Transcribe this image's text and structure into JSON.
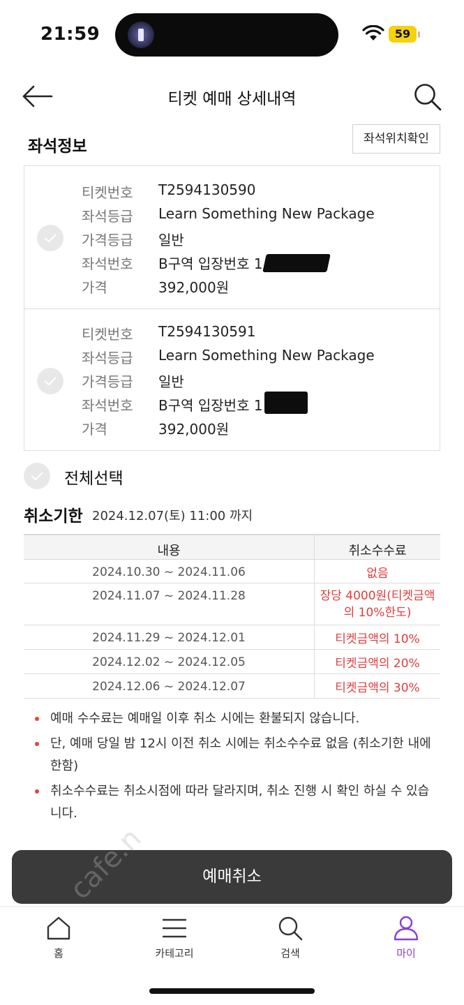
{
  "status_bar": {
    "time": "21:59",
    "battery": "59"
  },
  "header": {
    "title": "티켓 예매 상세내역"
  },
  "seat_info": {
    "section_title": "좌석정보",
    "locate_button": "좌석위치확인",
    "labels": {
      "ticket_no": "티켓번호",
      "seat_grade": "좌석등급",
      "price_grade": "가격등급",
      "seat_no": "좌석번호",
      "price": "가격"
    },
    "tickets": [
      {
        "ticket_no": "T2594130590",
        "seat_grade": "Learn Something New Package",
        "price_grade": "일반",
        "seat_no": "B구역 입장번호 1",
        "price": "392,000원"
      },
      {
        "ticket_no": "T2594130591",
        "seat_grade": "Learn Something New Package",
        "price_grade": "일반",
        "seat_no": "B구역 입장번호 1",
        "price": "392,000원"
      }
    ],
    "select_all": "전체선택"
  },
  "deadline": {
    "title": "취소기한",
    "value": "2024.12.07(토) 11:00 까지"
  },
  "fee_table": {
    "headers": {
      "period": "내용",
      "fee": "취소수수료"
    },
    "rows": [
      {
        "period": "2024.10.30 ~ 2024.11.06",
        "fee": "없음"
      },
      {
        "period": "2024.11.07 ~ 2024.11.28",
        "fee": "장당 4000원(티켓금액의 10%한도)"
      },
      {
        "period": "2024.11.29 ~ 2024.12.01",
        "fee": "티켓금액의 10%"
      },
      {
        "period": "2024.12.02 ~ 2024.12.05",
        "fee": "티켓금액의 20%"
      },
      {
        "period": "2024.12.06 ~ 2024.12.07",
        "fee": "티켓금액의 30%"
      }
    ]
  },
  "notes": [
    "예매 수수료는 예매일 이후 취소 시에는 환불되지 않습니다.",
    "단, 예매 당일 밤 12시 이전 취소 시에는 취소수수료 없음 (취소기한 내에 한함)",
    "취소수수료는 취소시점에 따라 달라지며, 취소 진행 시 확인 하실 수 있습니다."
  ],
  "cancel_button": "예매취소",
  "watermark": "cafe.n",
  "tab_bar": {
    "tabs": [
      {
        "label": "홈",
        "icon": "home-icon"
      },
      {
        "label": "카테고리",
        "icon": "menu-icon"
      },
      {
        "label": "검색",
        "icon": "search-icon"
      },
      {
        "label": "마이",
        "icon": "person-icon"
      }
    ],
    "active_color": "#8a3fd1"
  },
  "colors": {
    "accent_red": "#e03c3c",
    "button_dark": "#3a3a3a",
    "battery": "#f5d20a"
  }
}
